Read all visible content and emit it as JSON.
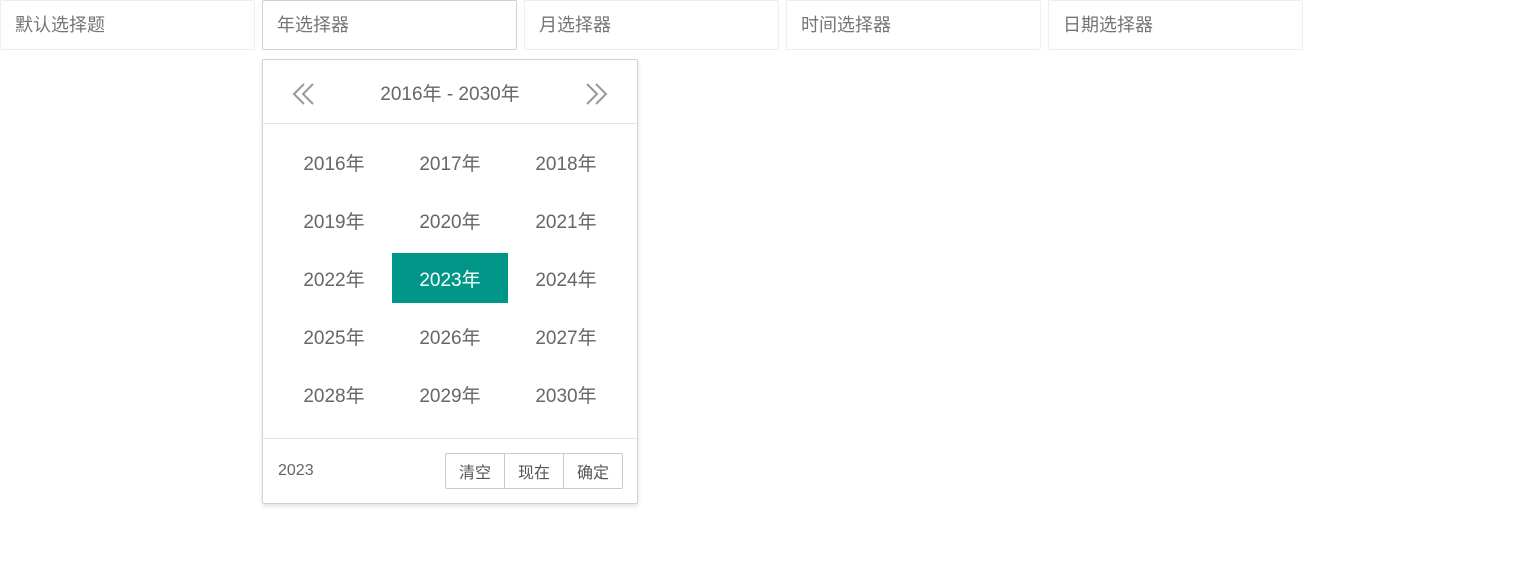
{
  "inputs": {
    "default": {
      "placeholder": "默认选择题"
    },
    "year": {
      "placeholder": "年选择器"
    },
    "month": {
      "placeholder": "月选择器"
    },
    "time": {
      "placeholder": "时间选择器"
    },
    "date": {
      "placeholder": "日期选择器"
    }
  },
  "panel": {
    "range_title": "2016年 - 2030年",
    "prev_icon": "double-chevron-left-icon",
    "next_icon": "double-chevron-right-icon",
    "years": [
      "2016年",
      "2017年",
      "2018年",
      "2019年",
      "2020年",
      "2021年",
      "2022年",
      "2023年",
      "2024年",
      "2025年",
      "2026年",
      "2027年",
      "2028年",
      "2029年",
      "2030年"
    ],
    "selected_year": "2023年",
    "footer": {
      "value": "2023",
      "clear_label": "清空",
      "now_label": "现在",
      "confirm_label": "确定"
    }
  },
  "colors": {
    "accent": "#009688",
    "text": "#666666",
    "border": "#d2d2d2"
  }
}
